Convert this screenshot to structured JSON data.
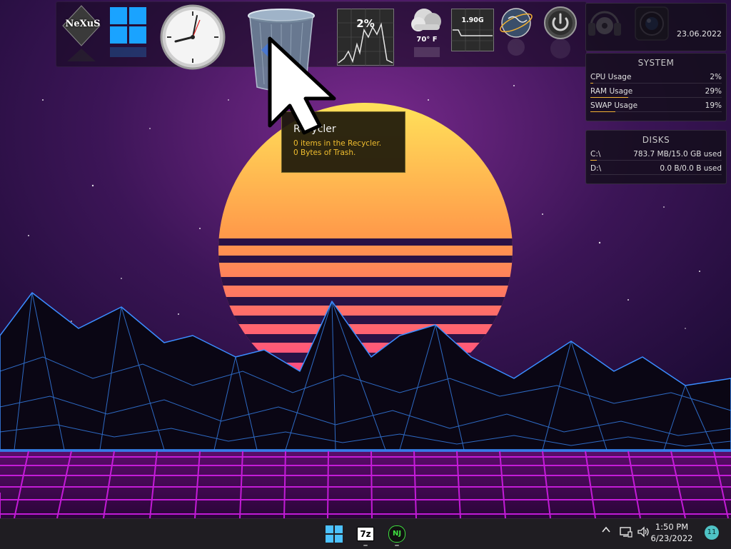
{
  "dock": {
    "items": [
      {
        "name": "nexus-logo",
        "label": "NeXuS"
      },
      {
        "name": "windows-start"
      },
      {
        "name": "clock"
      },
      {
        "name": "recycler"
      },
      {
        "name": "cpu-meter",
        "value": "2%"
      },
      {
        "name": "weather",
        "value": "70° F"
      },
      {
        "name": "memory-meter",
        "value": "1.90G"
      },
      {
        "name": "network-globe"
      },
      {
        "name": "power"
      },
      {
        "name": "media-player"
      },
      {
        "name": "camera"
      }
    ]
  },
  "date_panel": {
    "date": "23.06.2022"
  },
  "system_panel": {
    "title": "SYSTEM",
    "rows": [
      {
        "label": "CPU Usage",
        "value": "2%",
        "fraction": 0.02
      },
      {
        "label": "RAM Usage",
        "value": "29%",
        "fraction": 0.29
      },
      {
        "label": "SWAP Usage",
        "value": "19%",
        "fraction": 0.19
      }
    ]
  },
  "disks_panel": {
    "title": "DISKS",
    "rows": [
      {
        "label": "C:\\",
        "value": "783.7 MB/15.0 GB used",
        "fraction": 0.05
      },
      {
        "label": "D:\\",
        "value": "0.0 B/0.0 B used",
        "fraction": 0.0
      }
    ]
  },
  "tooltip": {
    "title": "Recycler",
    "line1": "0 items in the Recycler.",
    "line2": "0 Bytes of Trash."
  },
  "taskbar": {
    "apps": [
      {
        "name": "start-button"
      },
      {
        "name": "7zip-app",
        "label": "7z"
      },
      {
        "name": "nexus-app",
        "label": "NJ"
      }
    ],
    "tray": {
      "chevron": "^",
      "time": "1:50 PM",
      "date": "6/23/2022",
      "notifications": "11"
    }
  },
  "colors": {
    "accent_yellow": "#f2bf2f",
    "bar_orange": "#f2b233",
    "notif_teal": "#4fc3c6",
    "grid_magenta": "#d21ee6",
    "mountain_blue": "#3a8cff"
  }
}
